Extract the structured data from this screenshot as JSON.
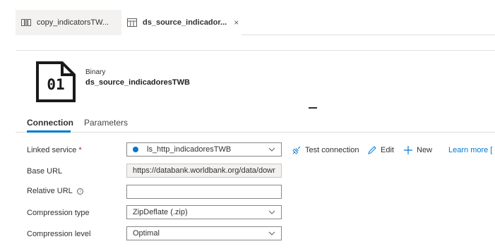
{
  "tabs": [
    {
      "label": "copy_indicatorsTW...",
      "icon": "pipeline-icon"
    },
    {
      "label": "ds_source_indicador...",
      "icon": "table-icon",
      "close": "×"
    }
  ],
  "dataset": {
    "icon_text": "01",
    "type": "Binary",
    "name": "ds_source_indicadoresTWB"
  },
  "subtabs": {
    "connection": "Connection",
    "parameters": "Parameters"
  },
  "form": {
    "linked_service": {
      "label": "Linked service",
      "required": "*",
      "value": "ls_http_indicadoresTWB"
    },
    "base_url": {
      "label": "Base URL",
      "value": "https://databank.worldbank.org/data/dowr"
    },
    "relative_url": {
      "label": "Relative URL",
      "info": "i",
      "value": ""
    },
    "compression_type": {
      "label": "Compression type",
      "value": "ZipDeflate (.zip)"
    },
    "compression_level": {
      "label": "Compression level",
      "value": "Optimal"
    }
  },
  "actions": {
    "test_connection": "Test connection",
    "edit": "Edit",
    "new": "New",
    "learn_more": "Learn more ["
  },
  "colors": {
    "accent": "#0078d4",
    "required": "#a4262c"
  }
}
